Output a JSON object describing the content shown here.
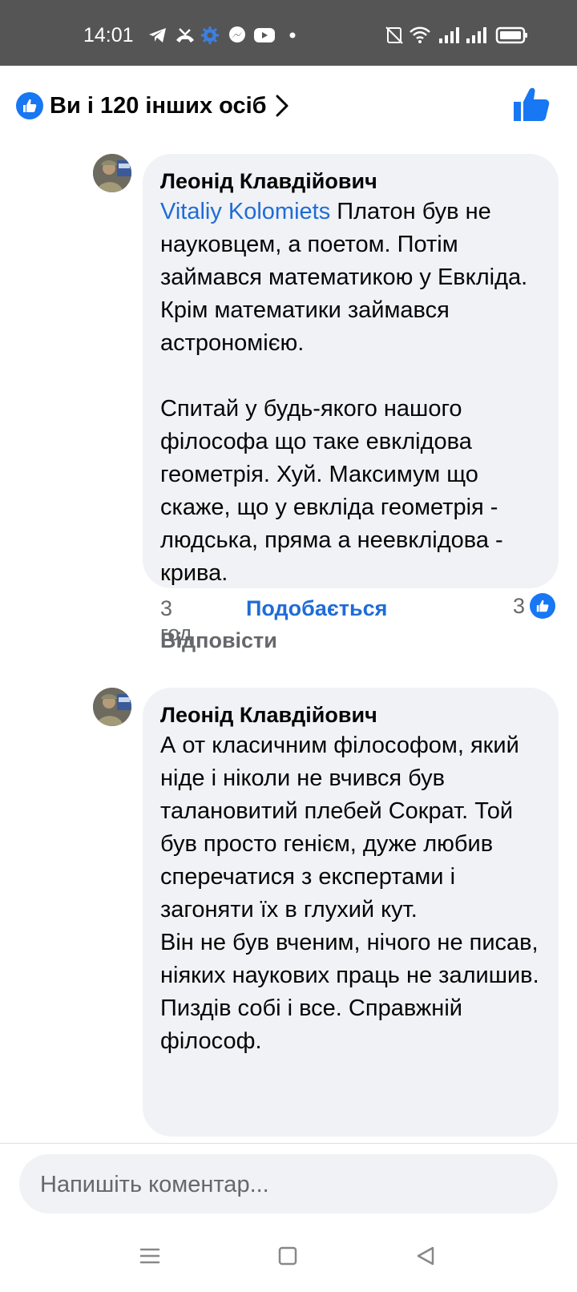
{
  "status_bar": {
    "time": "14:01"
  },
  "header": {
    "likes_text": "Ви і 120 інших осіб"
  },
  "comments": [
    {
      "author": "Леонід Клавдійович",
      "mention": "Vitaliy Kolomiets",
      "text": " Платон був не науковцем, а поетом. Потім займався математикою у Евкліда. Крім математики займався астрономією.\n\nСпитай у будь-якого нашого філософа що таке евклідова геометрія. Хуй. Максимум що скаже, що у евкліда геометрія - людська, пряма а неевклідова - крива.",
      "time": "3 год",
      "like_label": "Подобається",
      "reply_label": "Відповісти",
      "reactions": "3"
    },
    {
      "author": "Леонід Клавдійович",
      "text": "А от класичним філософом, який ніде і ніколи не вчився був талановитий плебей Сократ. Той був просто генієм, дуже любив сперечатися з експертами і загоняти їх в глухий кут.\nВін не був вченим, нічого не писав, ніяких наукових праць не залишив.\nПиздів собі і все. Справжній філософ."
    }
  ],
  "composer": {
    "placeholder": "Напишіть коментар..."
  },
  "colors": {
    "accent": "#1877f2",
    "link": "#1f6cd6",
    "bubble": "#f0f2f5",
    "status_bar": "#555555"
  }
}
